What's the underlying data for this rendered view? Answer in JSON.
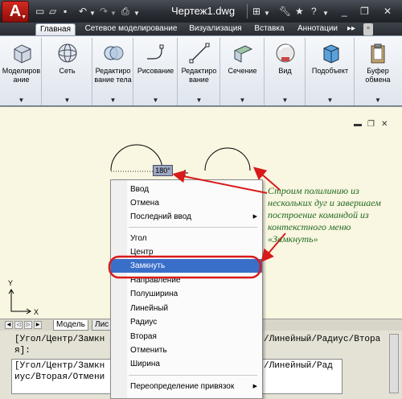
{
  "title_bar": {
    "app_button": "A",
    "document_title": "Чертеж1.dwg"
  },
  "ribbon_tabs": [
    {
      "label": "Главная",
      "active": true
    },
    {
      "label": "Сетевое моделирование",
      "active": false
    },
    {
      "label": "Визуализация",
      "active": false
    },
    {
      "label": "Вставка",
      "active": false
    },
    {
      "label": "Аннотации",
      "active": false
    }
  ],
  "ribbon_groups": [
    {
      "label": "Моделиров ание",
      "icon": "box-3d-icon"
    },
    {
      "label": "Сеть",
      "icon": "mesh-sphere-icon"
    },
    {
      "label": "Редактиро вание тела",
      "icon": "solid-edit-icon"
    },
    {
      "label": "Рисование",
      "icon": "draw-polyline-icon"
    },
    {
      "label": "Редактиро вание",
      "icon": "modify-icon"
    },
    {
      "label": "Сечение",
      "icon": "section-plane-icon"
    },
    {
      "label": "Вид",
      "icon": "view-sphere-icon"
    },
    {
      "label": "Подобъект",
      "icon": "subobject-cube-icon"
    },
    {
      "label": "Буфер обмена",
      "icon": "clipboard-icon"
    }
  ],
  "drawing": {
    "angle_tooltip": "180°",
    "ucs_y": "Y",
    "ucs_x": "X"
  },
  "layout_tabs": [
    {
      "label": "Модель"
    },
    {
      "label": "Лис"
    }
  ],
  "command_line": {
    "line1": "[Угол/Центр/Замкн",
    "line1_end": "/Линейный/Радиус/Втора",
    "line2": "я]:",
    "line3": "[Угол/Центр/Замкн",
    "line3_end": "/Линейный/Рад",
    "line4": "иус/Вторая/Отмени"
  },
  "context_menu": {
    "items": [
      {
        "label": "Ввод"
      },
      {
        "label": "Отмена"
      },
      {
        "label": "Последний ввод",
        "submenu": true
      },
      {
        "label": "Угол"
      },
      {
        "label": "Центр"
      },
      {
        "label": "Замкнуть",
        "selected": true
      },
      {
        "label": "Направление"
      },
      {
        "label": "Полуширина"
      },
      {
        "label": "Линейный"
      },
      {
        "label": "Радиус"
      },
      {
        "label": "Вторая"
      },
      {
        "label": "Отменить"
      },
      {
        "label": "Ширина"
      },
      {
        "label": "Переопределение привязок",
        "submenu": true
      }
    ]
  },
  "annotation": "Строим полилинию из нескольких дуг и завершаем построение командой из контекстного меню «Замкнуть»",
  "colors": {
    "annotation_text": "#1f6a1f",
    "annotation_arrow": "#d91a1a",
    "menu_selection": "#3a6fc9",
    "drawing_bg": "#f9f6e1"
  }
}
